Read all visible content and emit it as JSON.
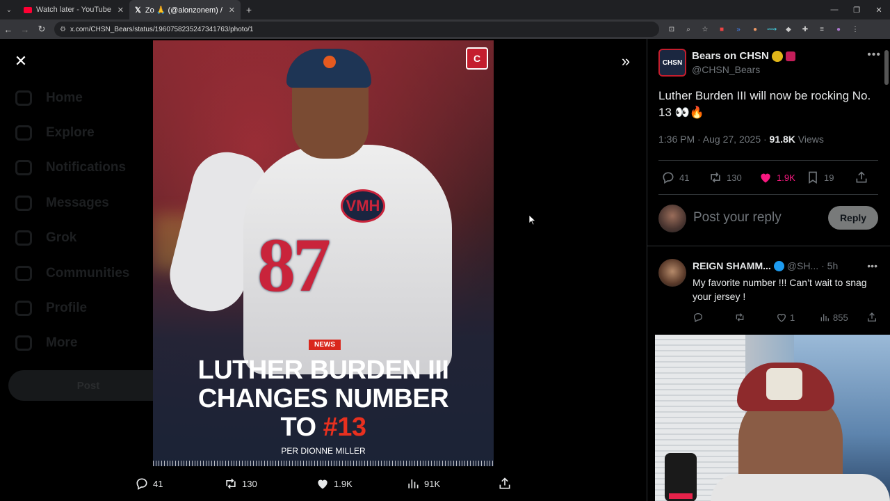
{
  "browser": {
    "tabs": [
      {
        "title": "Watch later - YouTube",
        "icon": "youtube-icon",
        "active": false
      },
      {
        "title": "Zo 🙏 (@alonzonem) / X",
        "icon": "x-icon",
        "active": true
      }
    ],
    "url": "x.com/CHSN_Bears/status/1960758235247341763/photo/1"
  },
  "background_nav": {
    "items": [
      "Home",
      "Explore",
      "Notifications",
      "Messages",
      "Grok",
      "Communities",
      "Profile",
      "More"
    ],
    "post_label": "Post"
  },
  "photo": {
    "logo_text": "C",
    "jersey_number": "87",
    "vmh_text": "VMH",
    "news_badge": "NEWS",
    "headline_line1": "LUTHER BURDEN III",
    "headline_line2": "CHANGES NUMBER",
    "headline_line3_prefix": "TO ",
    "headline_line3_highlight": "#13",
    "per_line": "PER DIONNE MILLER"
  },
  "photo_actions": {
    "replies": "41",
    "reposts": "130",
    "likes": "1.9K",
    "views": "91K"
  },
  "tweet": {
    "author_name": "Bears on CHSN",
    "author_handle": "@CHSN_Bears",
    "avatar_text": "CHSN",
    "text": "Luther Burden III will now be rocking No. 13 👀🔥",
    "time": "1:36 PM · Aug 27, 2025 · ",
    "views_count": "91.8K",
    "views_label": " Views",
    "replies": "41",
    "reposts": "130",
    "likes": "1.9K",
    "bookmarks": "19"
  },
  "reply_box": {
    "placeholder": "Post your reply",
    "button": "Reply"
  },
  "comment": {
    "name": "REIGN SHAMM...",
    "handle": "@SH...",
    "time": "· 5h",
    "text": "My favorite number !!! Can’t wait to snag your jersey !",
    "likes": "1",
    "views": "855"
  },
  "colors": {
    "like_pink": "#f91880",
    "verified_blue": "#1d9bf0",
    "headline_red": "#e8301f"
  }
}
